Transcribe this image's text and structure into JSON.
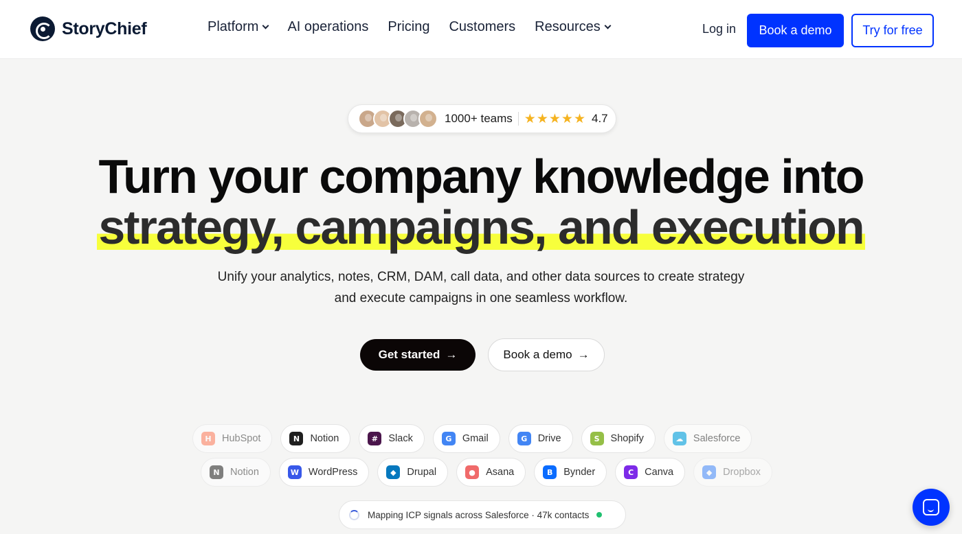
{
  "header": {
    "logo_text": "StoryChief",
    "nav": [
      {
        "label": "Platform",
        "has_dropdown": true
      },
      {
        "label": "AI operations",
        "has_dropdown": false
      },
      {
        "label": "Pricing",
        "has_dropdown": false
      },
      {
        "label": "Customers",
        "has_dropdown": false
      },
      {
        "label": "Resources",
        "has_dropdown": true
      }
    ],
    "login_label": "Log in",
    "book_demo_label": "Book a demo",
    "try_free_label": "Try for free"
  },
  "social_proof": {
    "teams_label": "1000+ teams",
    "rating_value": "4.7",
    "stars": 5,
    "avatar_colors": [
      "#c9a78a",
      "#e2c3a6",
      "#7a6a5c",
      "#b8b2ad",
      "#d2b18f"
    ]
  },
  "hero": {
    "headline_line1": "Turn your company knowledge into",
    "headline_line2": "strategy, campaigns, and execution",
    "subheadline_line1": "Unify your analytics, notes, CRM, DAM, call data, and other data sources to create strategy",
    "subheadline_line2": "and execute campaigns in one seamless workflow.",
    "get_started_label": "Get started",
    "book_demo_label": "Book a demo",
    "arrow_glyph": "→"
  },
  "integrations": {
    "row1": [
      {
        "name": "HubSpot",
        "icon": "hubspot-icon",
        "color": "#ff7a59",
        "glyph": "H"
      },
      {
        "name": "Notion",
        "icon": "notion-icon",
        "color": "#1f1f1f",
        "glyph": "N"
      },
      {
        "name": "Slack",
        "icon": "slack-icon",
        "color": "#4a154b",
        "glyph": "#"
      },
      {
        "name": "Gmail",
        "icon": "gmail-icon",
        "color": "#4285f4",
        "glyph": "G"
      },
      {
        "name": "Drive",
        "icon": "drive-icon",
        "color": "#4285f4",
        "glyph": "G"
      },
      {
        "name": "Shopify",
        "icon": "shopify-icon",
        "color": "#95bf47",
        "glyph": "S"
      },
      {
        "name": "Salesforce",
        "icon": "salesforce-icon",
        "color": "#00a1e0",
        "glyph": "☁"
      }
    ],
    "row2": [
      {
        "name": "Notion",
        "icon": "notion-icon",
        "color": "#1f1f1f",
        "glyph": "N"
      },
      {
        "name": "WordPress",
        "icon": "wordpress-icon",
        "color": "#3858e9",
        "glyph": "W"
      },
      {
        "name": "Drupal",
        "icon": "drupal-icon",
        "color": "#0678be",
        "glyph": "◆"
      },
      {
        "name": "Asana",
        "icon": "asana-icon",
        "color": "#f06a6a",
        "glyph": "●"
      },
      {
        "name": "Bynder",
        "icon": "bynder-icon",
        "color": "#0a6cff",
        "glyph": "B"
      },
      {
        "name": "Canva",
        "icon": "canva-icon",
        "color": "#7d2ae8",
        "glyph": "C"
      },
      {
        "name": "Dropbox",
        "icon": "dropbox-icon",
        "color": "#0061ff",
        "glyph": "◆"
      }
    ]
  },
  "status": {
    "text": "Mapping ICP signals across Salesforce · 47k contacts",
    "dot_color": "#20c070"
  },
  "colors": {
    "accent": "#0033ff",
    "highlight": "#f7ff3c",
    "star": "#f5b320"
  }
}
